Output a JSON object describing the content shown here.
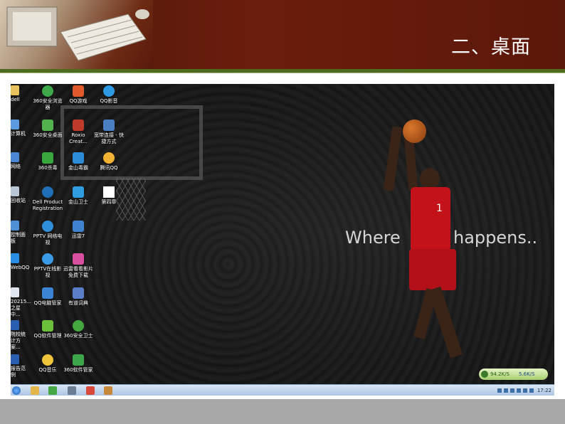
{
  "slide": {
    "title": "二、桌面",
    "colors": {
      "header": "#6b1d0e",
      "rule": "#4f6b1f",
      "footer": "#a8a8a8"
    }
  },
  "desktop": {
    "wallpaper_text": {
      "part1": "Where",
      "part2": "happens.."
    },
    "jersey_number": "1",
    "edge_icons": [
      {
        "label": "dell",
        "icon": "folder-icon"
      },
      {
        "label": "计算机",
        "icon": "computer-icon"
      },
      {
        "label": "网络",
        "icon": "network-icon"
      },
      {
        "label": "回收站",
        "icon": "recycle-bin-icon"
      },
      {
        "label": "控制面板",
        "icon": "control-panel-icon"
      },
      {
        "label": "WebQQ",
        "icon": "webqq-icon"
      },
      {
        "label": "20215... 之星中...",
        "icon": "document-icon"
      },
      {
        "label": "院校统计方案...",
        "icon": "word-doc-icon"
      },
      {
        "label": "报告范例",
        "icon": "word-doc-icon"
      }
    ],
    "icons_col2": [
      {
        "label": "360安全浏览器",
        "icon": "browser-icon"
      },
      {
        "label": "360安全桌面",
        "icon": "desktop-icon"
      },
      {
        "label": "360杀毒",
        "icon": "antivirus-icon"
      },
      {
        "label": "Dell Product Registration",
        "icon": "dell-icon"
      },
      {
        "label": "PPTV 网络电视",
        "icon": "pptv-icon"
      },
      {
        "label": "PPTV在线影视",
        "icon": "pptv-ie-icon"
      },
      {
        "label": "QQ电脑管家",
        "icon": "qq-manager-icon"
      },
      {
        "label": "QQ软件管理",
        "icon": "qq-software-icon"
      },
      {
        "label": "QQ音乐",
        "icon": "qq-music-icon"
      }
    ],
    "icons_col3": [
      {
        "label": "QQ游戏",
        "icon": "qq-game-icon"
      },
      {
        "label": "Roxio Creat...",
        "icon": "roxio-icon"
      },
      {
        "label": "金山毒霸",
        "icon": "kingsoft-antivirus-icon"
      },
      {
        "label": "金山卫士",
        "icon": "kingsoft-guard-icon"
      },
      {
        "label": "迅雷7",
        "icon": "thunder-icon"
      },
      {
        "label": "迅雷看看影片免费下载",
        "icon": "xunlei-kankan-icon"
      },
      {
        "label": "有道词典",
        "icon": "youdao-icon"
      },
      {
        "label": "360安全卫士",
        "icon": "360-guard-icon"
      },
      {
        "label": "360软件管家",
        "icon": "360-software-icon"
      }
    ],
    "icons_col4": [
      {
        "label": "QQ影音",
        "icon": "qq-player-icon"
      },
      {
        "label": "宽带连接 - 快捷方式",
        "icon": "broadband-icon"
      },
      {
        "label": "腾讯QQ",
        "icon": "qq-icon"
      },
      {
        "label": "第四章",
        "icon": "blank-document-icon"
      }
    ],
    "net_gadget": {
      "down": "94.2K/S",
      "up": "5.6K/S"
    },
    "taskbar": {
      "clock": "17:22"
    }
  }
}
